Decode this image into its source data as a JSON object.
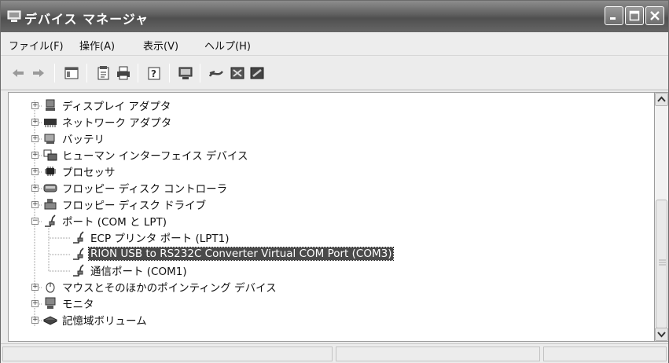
{
  "window": {
    "title": "デバイス マネージャ"
  },
  "menu": [
    {
      "label": "ファイル(F)"
    },
    {
      "label": "操作(A)"
    },
    {
      "label": "表示(V)"
    },
    {
      "label": "ヘルプ(H)"
    }
  ],
  "toolbar": {
    "icons": [
      "back-arrow-icon",
      "forward-arrow-icon",
      "console-tree-icon",
      "properties-icon",
      "print-icon",
      "help-icon",
      "scan-hardware-icon",
      "update-driver-icon",
      "uninstall-icon",
      "disable-icon"
    ]
  },
  "tree": {
    "items": [
      {
        "label": "ディスプレイ アダプタ",
        "icon": "display-adapter-icon",
        "expanded": false
      },
      {
        "label": "ネットワーク アダプタ",
        "icon": "network-adapter-icon",
        "expanded": false
      },
      {
        "label": "バッテリ",
        "icon": "battery-icon",
        "expanded": false
      },
      {
        "label": "ヒューマン インターフェイス デバイス",
        "icon": "hid-icon",
        "expanded": false
      },
      {
        "label": "プロセッサ",
        "icon": "processor-icon",
        "expanded": false
      },
      {
        "label": "フロッピー ディスク コントローラ",
        "icon": "floppy-controller-icon",
        "expanded": false
      },
      {
        "label": "フロッピー ディスク ドライブ",
        "icon": "floppy-drive-icon",
        "expanded": false
      },
      {
        "label": "ポート (COM と LPT)",
        "icon": "port-icon",
        "expanded": true
      },
      {
        "label": "ECP プリンタ ポート (LPT1)",
        "icon": "port-icon",
        "child": true
      },
      {
        "label": "RION USB to RS232C Converter Virtual COM Port (COM3)",
        "icon": "port-icon",
        "child": true,
        "selected": true
      },
      {
        "label": "通信ポート (COM1)",
        "icon": "port-icon",
        "child": true
      },
      {
        "label": "マウスとそのほかのポインティング デバイス",
        "icon": "mouse-icon",
        "expanded": false
      },
      {
        "label": "モニタ",
        "icon": "monitor-icon",
        "expanded": false
      },
      {
        "label": "記憶域ボリューム",
        "icon": "storage-volume-icon",
        "expanded": false
      }
    ]
  },
  "expander": {
    "collapsed": "+",
    "expanded": "−"
  },
  "colors": {
    "titlebar": "#5e5e5e",
    "selection": "#4a4a4a"
  }
}
